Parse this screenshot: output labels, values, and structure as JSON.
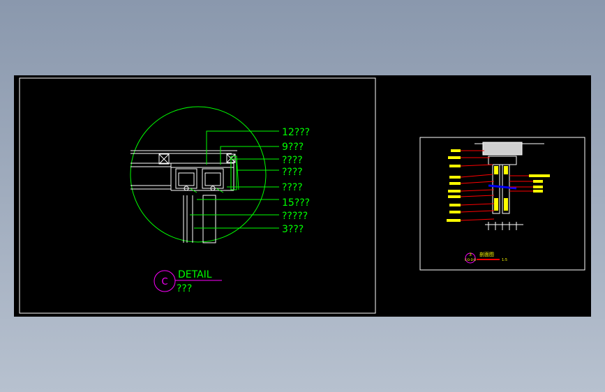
{
  "viewport": {
    "background": "#000000",
    "frame_color": "#ffffff",
    "detail_color": "#00ff00",
    "dim_color": "#ff0000",
    "label_color": "#ffff00",
    "circle_tag_color": "#ff00ff",
    "blue_color": "#0000ff"
  },
  "detail_callouts": [
    "12???",
    "9???",
    "????",
    "????",
    "????",
    "15???",
    "?????",
    "3???"
  ],
  "detail_title": {
    "tag": "C",
    "label": "DETAIL",
    "subtitle": "???"
  },
  "section": {
    "tag": "3",
    "tag_sub": "C-D-D-D",
    "title": "剖面图",
    "scale": "1:5"
  }
}
